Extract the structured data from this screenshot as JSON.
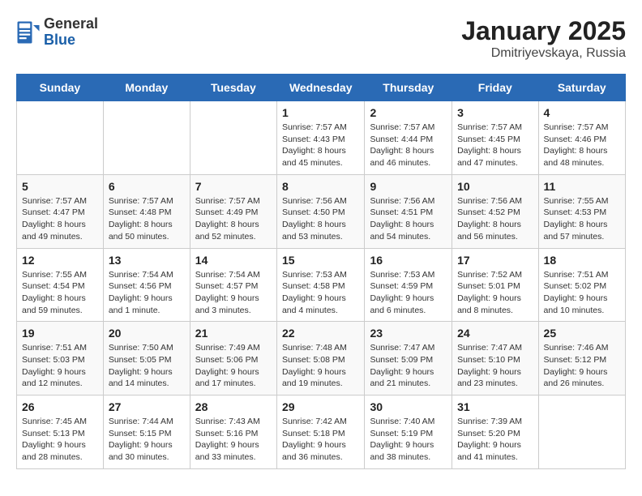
{
  "logo": {
    "general": "General",
    "blue": "Blue"
  },
  "header": {
    "title": "January 2025",
    "subtitle": "Dmitriyevskaya, Russia"
  },
  "weekdays": [
    "Sunday",
    "Monday",
    "Tuesday",
    "Wednesday",
    "Thursday",
    "Friday",
    "Saturday"
  ],
  "weeks": [
    [
      {
        "day": "",
        "info": ""
      },
      {
        "day": "",
        "info": ""
      },
      {
        "day": "",
        "info": ""
      },
      {
        "day": "1",
        "info": "Sunrise: 7:57 AM\nSunset: 4:43 PM\nDaylight: 8 hours\nand 45 minutes."
      },
      {
        "day": "2",
        "info": "Sunrise: 7:57 AM\nSunset: 4:44 PM\nDaylight: 8 hours\nand 46 minutes."
      },
      {
        "day": "3",
        "info": "Sunrise: 7:57 AM\nSunset: 4:45 PM\nDaylight: 8 hours\nand 47 minutes."
      },
      {
        "day": "4",
        "info": "Sunrise: 7:57 AM\nSunset: 4:46 PM\nDaylight: 8 hours\nand 48 minutes."
      }
    ],
    [
      {
        "day": "5",
        "info": "Sunrise: 7:57 AM\nSunset: 4:47 PM\nDaylight: 8 hours\nand 49 minutes."
      },
      {
        "day": "6",
        "info": "Sunrise: 7:57 AM\nSunset: 4:48 PM\nDaylight: 8 hours\nand 50 minutes."
      },
      {
        "day": "7",
        "info": "Sunrise: 7:57 AM\nSunset: 4:49 PM\nDaylight: 8 hours\nand 52 minutes."
      },
      {
        "day": "8",
        "info": "Sunrise: 7:56 AM\nSunset: 4:50 PM\nDaylight: 8 hours\nand 53 minutes."
      },
      {
        "day": "9",
        "info": "Sunrise: 7:56 AM\nSunset: 4:51 PM\nDaylight: 8 hours\nand 54 minutes."
      },
      {
        "day": "10",
        "info": "Sunrise: 7:56 AM\nSunset: 4:52 PM\nDaylight: 8 hours\nand 56 minutes."
      },
      {
        "day": "11",
        "info": "Sunrise: 7:55 AM\nSunset: 4:53 PM\nDaylight: 8 hours\nand 57 minutes."
      }
    ],
    [
      {
        "day": "12",
        "info": "Sunrise: 7:55 AM\nSunset: 4:54 PM\nDaylight: 8 hours\nand 59 minutes."
      },
      {
        "day": "13",
        "info": "Sunrise: 7:54 AM\nSunset: 4:56 PM\nDaylight: 9 hours\nand 1 minute."
      },
      {
        "day": "14",
        "info": "Sunrise: 7:54 AM\nSunset: 4:57 PM\nDaylight: 9 hours\nand 3 minutes."
      },
      {
        "day": "15",
        "info": "Sunrise: 7:53 AM\nSunset: 4:58 PM\nDaylight: 9 hours\nand 4 minutes."
      },
      {
        "day": "16",
        "info": "Sunrise: 7:53 AM\nSunset: 4:59 PM\nDaylight: 9 hours\nand 6 minutes."
      },
      {
        "day": "17",
        "info": "Sunrise: 7:52 AM\nSunset: 5:01 PM\nDaylight: 9 hours\nand 8 minutes."
      },
      {
        "day": "18",
        "info": "Sunrise: 7:51 AM\nSunset: 5:02 PM\nDaylight: 9 hours\nand 10 minutes."
      }
    ],
    [
      {
        "day": "19",
        "info": "Sunrise: 7:51 AM\nSunset: 5:03 PM\nDaylight: 9 hours\nand 12 minutes."
      },
      {
        "day": "20",
        "info": "Sunrise: 7:50 AM\nSunset: 5:05 PM\nDaylight: 9 hours\nand 14 minutes."
      },
      {
        "day": "21",
        "info": "Sunrise: 7:49 AM\nSunset: 5:06 PM\nDaylight: 9 hours\nand 17 minutes."
      },
      {
        "day": "22",
        "info": "Sunrise: 7:48 AM\nSunset: 5:08 PM\nDaylight: 9 hours\nand 19 minutes."
      },
      {
        "day": "23",
        "info": "Sunrise: 7:47 AM\nSunset: 5:09 PM\nDaylight: 9 hours\nand 21 minutes."
      },
      {
        "day": "24",
        "info": "Sunrise: 7:47 AM\nSunset: 5:10 PM\nDaylight: 9 hours\nand 23 minutes."
      },
      {
        "day": "25",
        "info": "Sunrise: 7:46 AM\nSunset: 5:12 PM\nDaylight: 9 hours\nand 26 minutes."
      }
    ],
    [
      {
        "day": "26",
        "info": "Sunrise: 7:45 AM\nSunset: 5:13 PM\nDaylight: 9 hours\nand 28 minutes."
      },
      {
        "day": "27",
        "info": "Sunrise: 7:44 AM\nSunset: 5:15 PM\nDaylight: 9 hours\nand 30 minutes."
      },
      {
        "day": "28",
        "info": "Sunrise: 7:43 AM\nSunset: 5:16 PM\nDaylight: 9 hours\nand 33 minutes."
      },
      {
        "day": "29",
        "info": "Sunrise: 7:42 AM\nSunset: 5:18 PM\nDaylight: 9 hours\nand 36 minutes."
      },
      {
        "day": "30",
        "info": "Sunrise: 7:40 AM\nSunset: 5:19 PM\nDaylight: 9 hours\nand 38 minutes."
      },
      {
        "day": "31",
        "info": "Sunrise: 7:39 AM\nSunset: 5:20 PM\nDaylight: 9 hours\nand 41 minutes."
      },
      {
        "day": "",
        "info": ""
      }
    ]
  ]
}
